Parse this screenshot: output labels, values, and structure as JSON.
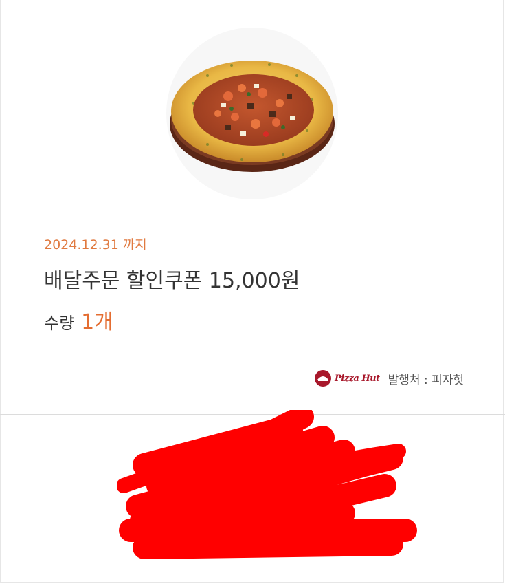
{
  "coupon": {
    "image_alt": "pizza",
    "expiry": "2024.12.31 까지",
    "title": "배달주문 할인쿠폰 15,000원",
    "quantity_label": "수량",
    "quantity_value": "1개",
    "brand_logo_text": "Pizza Hut",
    "issuer": "발행처 : 피자헛"
  },
  "colors": {
    "accent": "#e46d31",
    "brand": "#a8182b",
    "redaction": "#ff0000"
  }
}
